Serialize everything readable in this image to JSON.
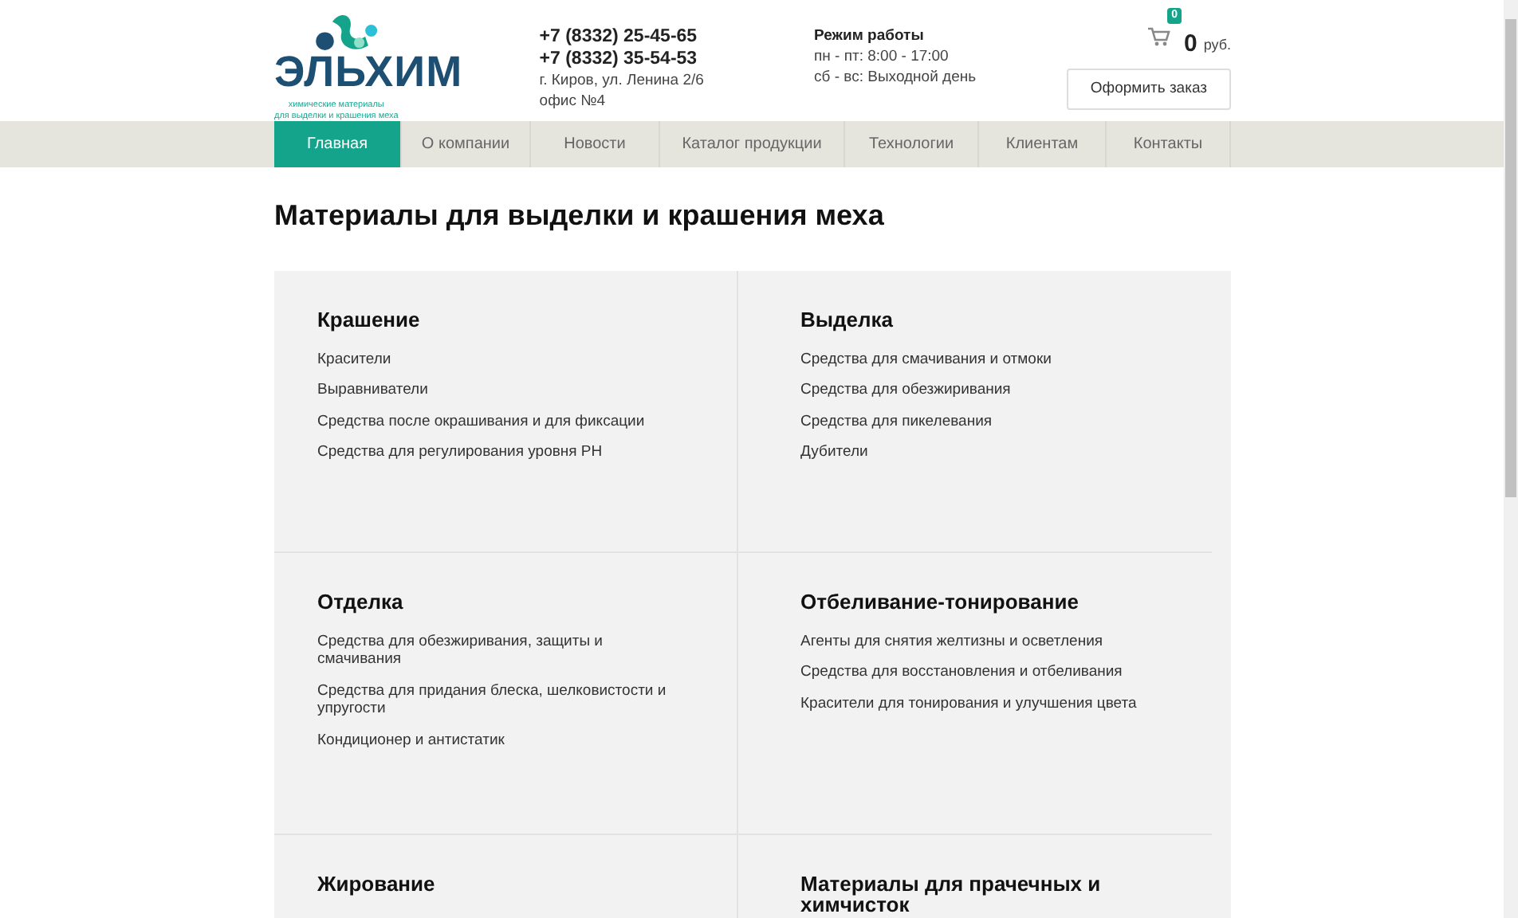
{
  "logo": {
    "name": "ЭЛЬХИМ",
    "tagline_lines": [
      "химические материалы",
      "для выделки и крашения меха"
    ]
  },
  "contacts": {
    "phones": [
      "+7 (8332) 25-45-65",
      "+7 (8332) 35-54-53"
    ],
    "address_lines": [
      "г. Киров, ул. Ленина 2/6",
      "офис №4"
    ]
  },
  "hours": {
    "title": "Режим работы",
    "lines": [
      "пн - пт: 8:00 - 17:00",
      "сб - вс: Выходной день"
    ]
  },
  "cart": {
    "count": "0",
    "total": "0",
    "currency": "руб.",
    "order_button": "Оформить заказ"
  },
  "nav": [
    {
      "label": "Главная",
      "selected": true
    },
    {
      "label": "О компании",
      "selected": false
    },
    {
      "label": "Новости",
      "selected": false
    },
    {
      "label": "Каталог продукции",
      "selected": false
    },
    {
      "label": "Технологии",
      "selected": false
    },
    {
      "label": "Клиентам",
      "selected": false
    },
    {
      "label": "Контакты",
      "selected": false
    }
  ],
  "page_title": "Материалы для выделки и крашения меха",
  "categories": [
    {
      "title": "Крашение",
      "items": [
        "Красители",
        "Выравниватели",
        "Средства после окрашивания и для фиксации",
        "Средства для регулирования уровня PH"
      ]
    },
    {
      "title": "Выделка",
      "items": [
        "Средства для смачивания и отмоки",
        "Средства для обезжиривания",
        "Средства для пикелевания",
        "Дубители"
      ]
    },
    {
      "title": "Отделка",
      "items": [
        "Средства для обезжиривания, защиты и смачивания",
        "Средства для придания блеска, шелковистости и упругости",
        "Кондиционер и антистатик"
      ]
    },
    {
      "title": "Отбеливание-тонирование",
      "items": [
        "Агенты для снятия желтизны и осветления",
        "Средства для восстановления и отбеливания",
        "Красители для тонирования и улучшения цвета"
      ]
    },
    {
      "title": "Жирование"
    },
    {
      "title": "Материалы для прачечных и химчисток"
    }
  ]
}
